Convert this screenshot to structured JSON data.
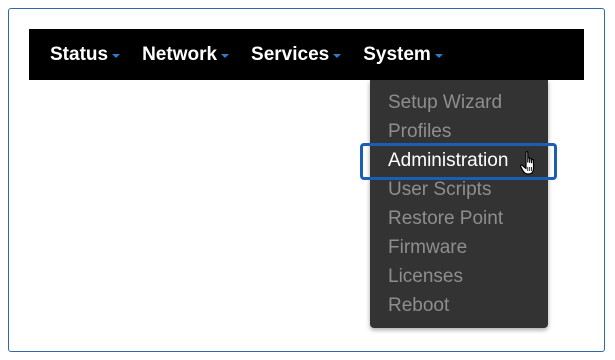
{
  "navbar": {
    "items": [
      {
        "label": "Status"
      },
      {
        "label": "Network"
      },
      {
        "label": "Services"
      },
      {
        "label": "System"
      }
    ]
  },
  "system_menu": {
    "items": [
      {
        "label": "Setup Wizard"
      },
      {
        "label": "Profiles"
      },
      {
        "label": "Administration",
        "state": "hovered"
      },
      {
        "label": "User Scripts"
      },
      {
        "label": "Restore Point"
      },
      {
        "label": "Firmware"
      },
      {
        "label": "Licenses"
      },
      {
        "label": "Reboot"
      }
    ]
  },
  "colors": {
    "navbar_bg": "#000000",
    "dropdown_bg": "#333333",
    "caret": "#2e7bc9",
    "highlight_border": "#1a5fb4",
    "menu_text": "#8e8e8e",
    "menu_text_active": "#ffffff"
  },
  "cursor": {
    "icon": "hand-pointer-icon"
  }
}
